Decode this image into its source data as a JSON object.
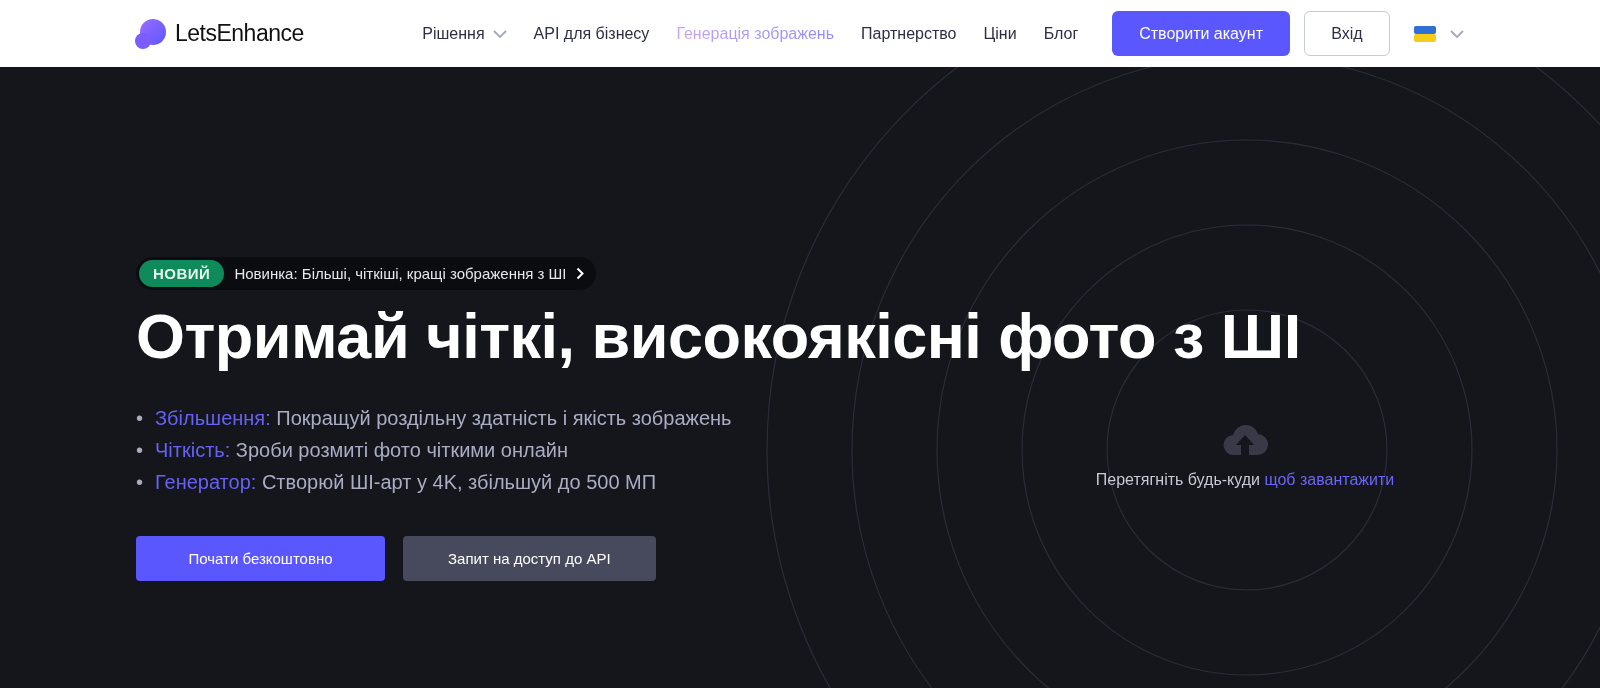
{
  "header": {
    "logo": "LetsEnhance",
    "nav": [
      {
        "label": "Рішення",
        "dropdown": true,
        "selected": false
      },
      {
        "label": "API для бізнесу",
        "dropdown": false,
        "selected": false
      },
      {
        "label": "Генерація зображень",
        "dropdown": false,
        "selected": true
      },
      {
        "label": "Партнерство",
        "dropdown": false,
        "selected": false
      },
      {
        "label": "Ціни",
        "dropdown": false,
        "selected": false
      },
      {
        "label": "Блог",
        "dropdown": false,
        "selected": false
      }
    ],
    "signup_button": "Створити акаунт",
    "login_button": "Вхід"
  },
  "hero": {
    "badge": {
      "tag": "НОВИЙ",
      "text": "Новинка: Більші, чіткіші, кращі зображення з ШІ"
    },
    "title": "Отримай чіткі, високоякісні фото з ШІ",
    "features": [
      {
        "bullet": "•",
        "label": "Збільшення:",
        "text": "Покращуй роздільну здатність і якість зображень"
      },
      {
        "bullet": "•",
        "label": "Чіткість:",
        "text": "Зроби розмиті фото чіткими онлайн"
      },
      {
        "bullet": "•",
        "label": "Генератор:",
        "text": "Створюй ШІ-арт у 4K, збільшуй до 500 МП"
      }
    ],
    "buttons": [
      {
        "label": "Почати безкоштовно",
        "kind": "primary"
      },
      {
        "label": "Запит на доступ до API",
        "kind": "secondary"
      }
    ],
    "upload": {
      "text": "Перетягніть будь-куди",
      "link": "щоб завантажити"
    }
  }
}
